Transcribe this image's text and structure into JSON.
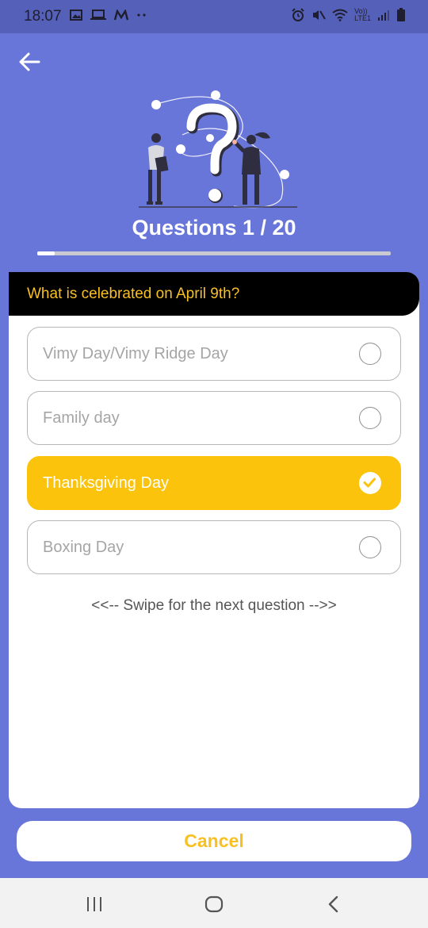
{
  "status_bar": {
    "time": "18:07",
    "left_icons": [
      "gallery-icon",
      "laptop-icon",
      "m-app-icon",
      "more-dots-icon"
    ],
    "right_icons": [
      "alarm-icon",
      "mute-icon",
      "wifi-icon",
      "volte-icon",
      "signal-icon",
      "battery-icon"
    ],
    "volte_label_top": "Vo))",
    "volte_label_bottom": "LTE1"
  },
  "header": {
    "back_icon": "arrow-left-icon",
    "illustration": "question-mark-people-illustration",
    "question_counter": "Questions 1 / 20",
    "progress": 0.05
  },
  "quiz": {
    "question": "What is celebrated on April 9th?",
    "options": [
      {
        "label": "Vimy Day/Vimy Ridge Day",
        "selected": false
      },
      {
        "label": "Family day",
        "selected": false
      },
      {
        "label": "Thanksgiving Day",
        "selected": true
      },
      {
        "label": "Boxing Day",
        "selected": false
      }
    ],
    "swipe_hint": "<<-- Swipe for the next question -->>"
  },
  "footer": {
    "cancel_label": "Cancel"
  },
  "navbar": {
    "items": [
      "recent-apps-icon",
      "home-icon",
      "back-icon"
    ]
  },
  "colors": {
    "background": "#6875D9",
    "accent": "#FBC30B",
    "question_bar": "#000000"
  }
}
